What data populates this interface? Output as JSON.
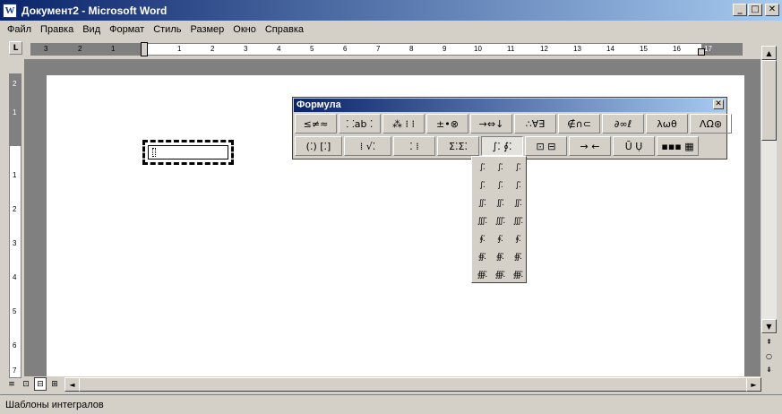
{
  "window": {
    "title": "Документ2 - Microsoft Word",
    "app_icon": "W",
    "minimize": "_",
    "maximize": "□",
    "close": "✕"
  },
  "menu": [
    "Файл",
    "Правка",
    "Вид",
    "Формат",
    "Стиль",
    "Размер",
    "Окно",
    "Справка"
  ],
  "ruler": {
    "tab_selector": "L",
    "h_labels": [
      "3",
      "2",
      "1",
      "1",
      "2",
      "3",
      "4",
      "5",
      "6",
      "7",
      "8",
      "9",
      "10",
      "11",
      "12",
      "13",
      "14",
      "15",
      "16",
      "17"
    ],
    "v_labels": [
      "2",
      "1",
      "1",
      "2",
      "3",
      "4",
      "5",
      "6",
      "7"
    ]
  },
  "formula_toolbar": {
    "title": "Формула",
    "close": "✕",
    "row1": [
      "≤≠≈",
      "⸬ab ⁚",
      "⁂ ⁞ ⁞",
      "±•⊗",
      "→⇔↓",
      "∴∀∃",
      "∉∩⊂",
      "∂∞ℓ",
      "λωθ",
      "ΛΩ⊛"
    ],
    "row2": [
      "(⁚) [⁚]",
      "⁞ √⁚",
      "⁚ ⁞",
      "Σ⁚Σ⁚",
      "∫⁚ ∮⁚",
      "⊡ ⊟",
      "→ ←",
      "Ū Ụ",
      "▪▪▪ ▦"
    ]
  },
  "integral_palette": [
    "∫⁚",
    "∫⁚",
    "∫⁚",
    "∫⁚",
    "∫⁚",
    "∫⁚",
    "∬⁚",
    "∬⁚",
    "∬⁚",
    "∭⁚",
    "∭⁚",
    "∭⁚",
    "∮⁚",
    "∮⁚",
    "∮⁚",
    "∯⁚",
    "∯⁚",
    "∯⁚",
    "∰⁚",
    "∰⁚",
    "∰⁚"
  ],
  "status": {
    "text": "Шаблоны интегралов"
  },
  "scroll": {
    "up": "▲",
    "down": "▼",
    "left": "◄",
    "right": "►",
    "prev_page": "⇞",
    "select_browse": "○",
    "next_page": "⇟"
  },
  "view_buttons": [
    "≡",
    "⊡",
    "⊟",
    "⊞"
  ],
  "colors": {
    "title_start": "#0a246a",
    "title_end": "#a6caf0",
    "face": "#d4d0c8"
  }
}
